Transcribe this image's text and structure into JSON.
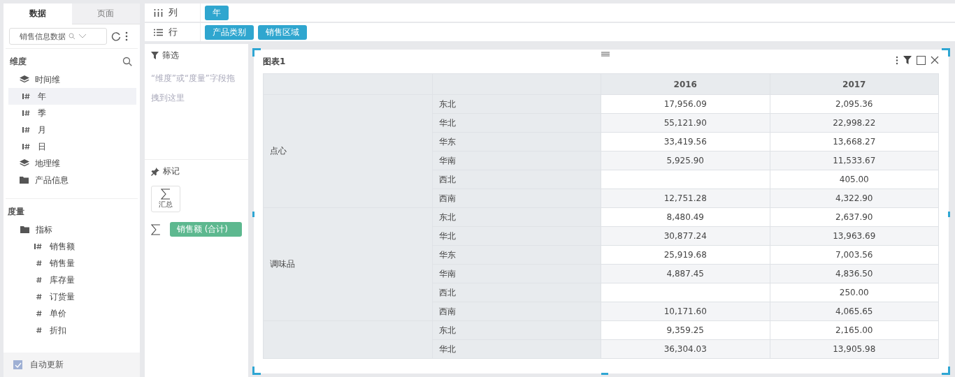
{
  "left_panel": {
    "tabs": [
      {
        "label": "数据",
        "selected": true
      },
      {
        "label": "页面",
        "selected": false
      }
    ],
    "dataset_select": {
      "value": "销售信息数据"
    },
    "dimensions": {
      "title": "维度",
      "items": [
        {
          "label": "时间维",
          "kind": "layer",
          "children": [
            {
              "label": "年",
              "kind": "marked",
              "selected": true
            },
            {
              "label": "季",
              "kind": "marked",
              "selected": false
            },
            {
              "label": "月",
              "kind": "marked",
              "selected": false
            },
            {
              "label": "日",
              "kind": "marked",
              "selected": false
            }
          ]
        },
        {
          "label": "地理维",
          "kind": "layer"
        },
        {
          "label": "产品信息",
          "kind": "folder"
        }
      ]
    },
    "measures": {
      "title": "度量",
      "items": [
        {
          "label": "指标",
          "kind": "folder",
          "children": [
            {
              "label": "销售额",
              "kind": "marked",
              "selected": false
            },
            {
              "label": "销售量",
              "kind": "plain",
              "selected": false
            },
            {
              "label": "库存量",
              "kind": "plain",
              "selected": false
            },
            {
              "label": "订货量",
              "kind": "plain",
              "selected": false
            },
            {
              "label": "单价",
              "kind": "plain",
              "selected": false
            },
            {
              "label": "折扣",
              "kind": "plain",
              "selected": false
            }
          ]
        }
      ]
    },
    "auto_update": {
      "label": "自动更新",
      "checked": true
    }
  },
  "shelves": [
    {
      "kind": "columns",
      "label": "列",
      "pills": [
        "年"
      ]
    },
    {
      "kind": "rows",
      "label": "行",
      "pills": [
        "产品类别",
        "销售区域"
      ]
    }
  ],
  "filter": {
    "title": "筛选",
    "hint": "“维度”或“度量”字段拖拽到这里"
  },
  "marks": {
    "title": "标记",
    "type_button": "汇总",
    "fields": [
      "销售额 (合计)"
    ]
  },
  "chart": {
    "title": "图表1",
    "columns": [
      "2016",
      "2017"
    ],
    "groups": [
      {
        "label": "点心",
        "rows": [
          {
            "region": "东北",
            "values": [
              "17,956.09",
              "2,095.36"
            ]
          },
          {
            "region": "华北",
            "values": [
              "55,121.90",
              "22,998.22"
            ]
          },
          {
            "region": "华东",
            "values": [
              "33,419.56",
              "13,668.27"
            ]
          },
          {
            "region": "华南",
            "values": [
              "5,925.90",
              "11,533.67"
            ]
          },
          {
            "region": "西北",
            "col_2": "405.00"
          },
          {
            "region": "西南",
            "values": [
              "12,751.28",
              "4,322.90"
            ]
          }
        ]
      },
      {
        "label": "调味品",
        "rows": [
          {
            "region": "东北",
            "values": [
              "8,480.49",
              "2,637.90"
            ]
          },
          {
            "region": "华北",
            "values": [
              "30,877.24",
              "13,963.69"
            ]
          },
          {
            "region": "华东",
            "values": [
              "25,919.68",
              "7,003.56"
            ]
          },
          {
            "region": "华南",
            "values": [
              "4,887.45",
              "4,836.50"
            ]
          },
          {
            "region": "西北",
            "col_2": "250.00"
          },
          {
            "region": "西南",
            "values": [
              "10,171.60",
              "4,065.65"
            ]
          }
        ]
      },
      {
        "rows": [
          {
            "region": "东北",
            "values": [
              "9,359.25",
              "2,165.00"
            ]
          },
          {
            "region": "华北",
            "values": [
              "36,304.03",
              "13,905.98"
            ]
          }
        ]
      }
    ]
  }
}
